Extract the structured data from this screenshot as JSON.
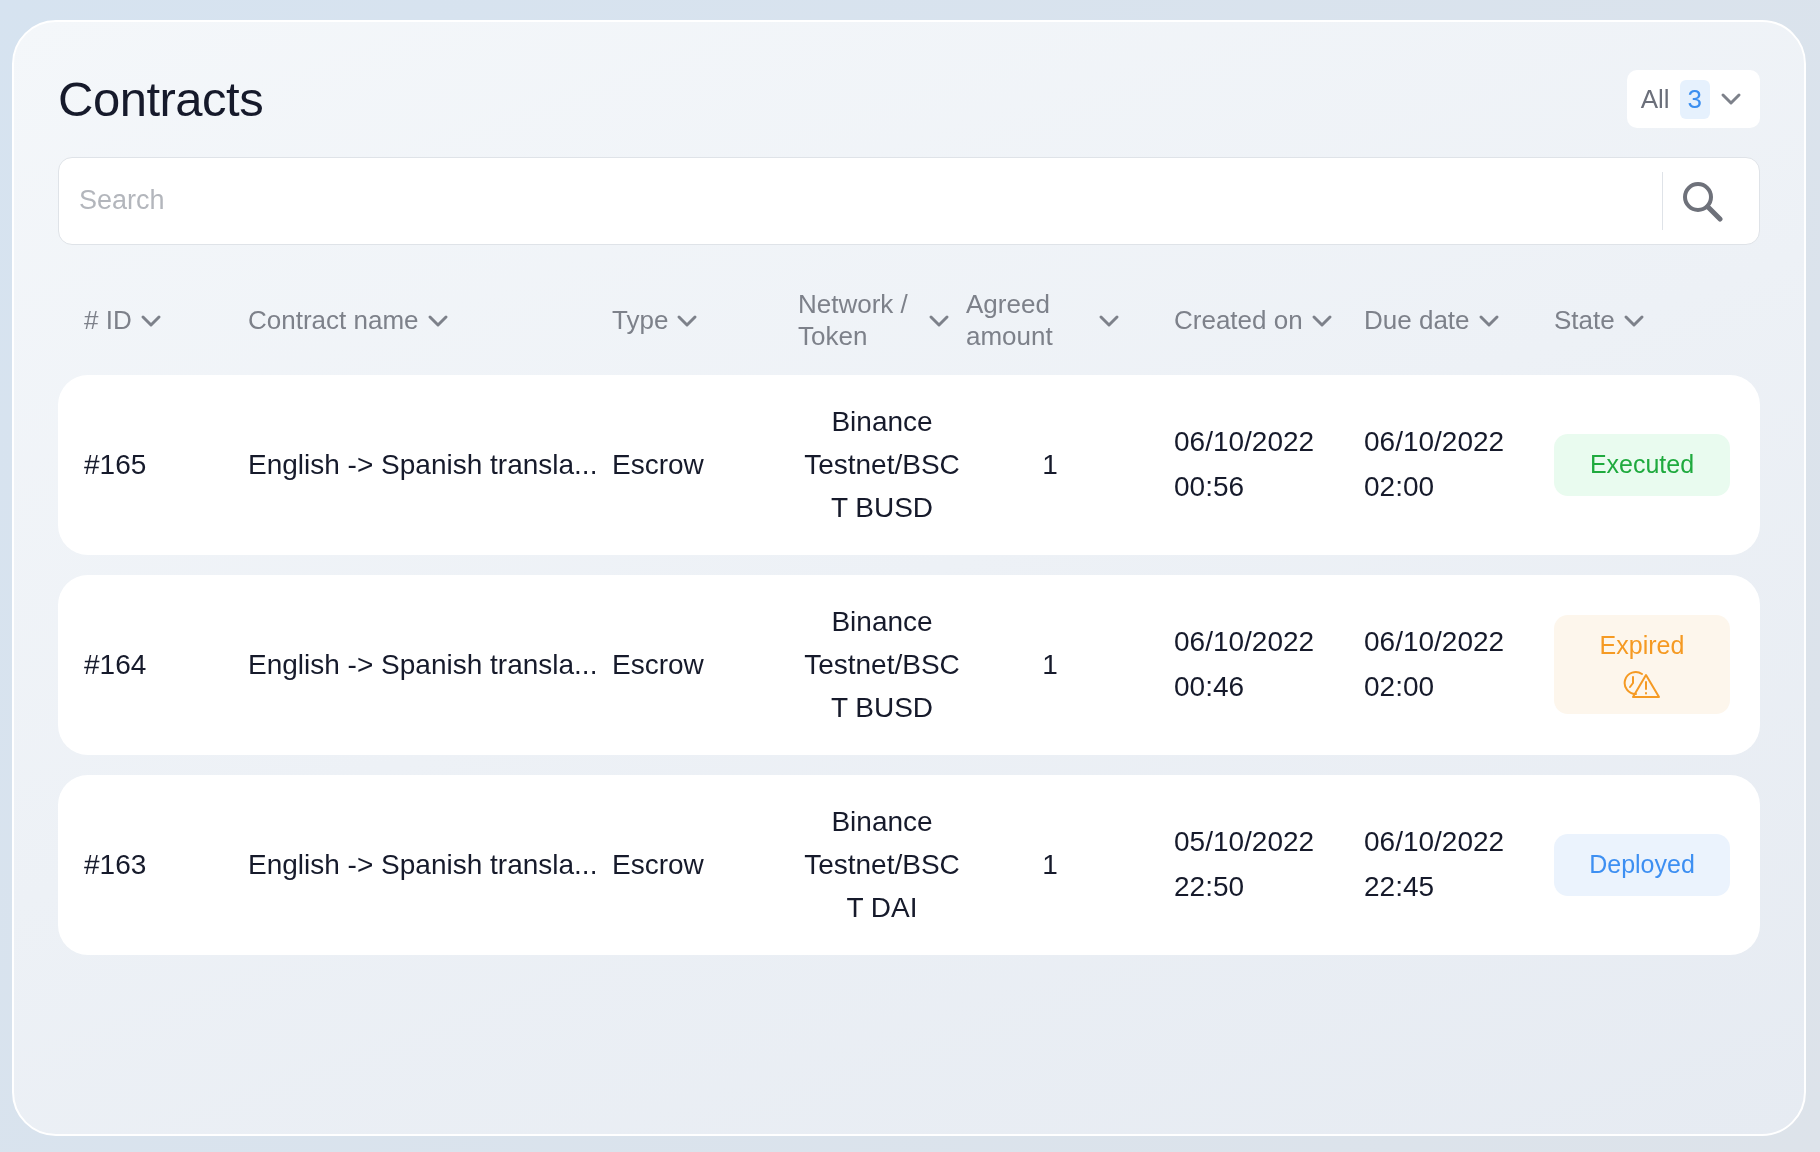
{
  "title": "Contracts",
  "filter": {
    "label": "All",
    "count": "3"
  },
  "search": {
    "placeholder": "Search"
  },
  "columns": [
    {
      "label": "# ID"
    },
    {
      "label": "Contract name"
    },
    {
      "label": "Type"
    },
    {
      "label": "Network / Token"
    },
    {
      "label": "Agreed amount"
    },
    {
      "label": "Created on"
    },
    {
      "label": "Due date"
    },
    {
      "label": "State"
    }
  ],
  "rows": [
    {
      "id": "#165",
      "name": "English -> Spanish transla...",
      "type": "Escrow",
      "network": [
        "Binance",
        "Testnet/BSC",
        "T BUSD"
      ],
      "amount": "1",
      "created": [
        "06/10/2022",
        "00:56"
      ],
      "due": [
        "06/10/2022",
        "02:00"
      ],
      "state": {
        "label": "Executed",
        "kind": "executed"
      }
    },
    {
      "id": "#164",
      "name": "English -> Spanish transla...",
      "type": "Escrow",
      "network": [
        "Binance",
        "Testnet/BSC",
        "T BUSD"
      ],
      "amount": "1",
      "created": [
        "06/10/2022",
        "00:46"
      ],
      "due": [
        "06/10/2022",
        "02:00"
      ],
      "state": {
        "label": "Expired",
        "kind": "expired"
      }
    },
    {
      "id": "#163",
      "name": "English -> Spanish transla...",
      "type": "Escrow",
      "network": [
        "Binance",
        "Testnet/BSC",
        "T DAI"
      ],
      "amount": "1",
      "created": [
        "05/10/2022",
        "22:50"
      ],
      "due": [
        "06/10/2022",
        "22:45"
      ],
      "state": {
        "label": "Deployed",
        "kind": "deployed"
      }
    }
  ]
}
